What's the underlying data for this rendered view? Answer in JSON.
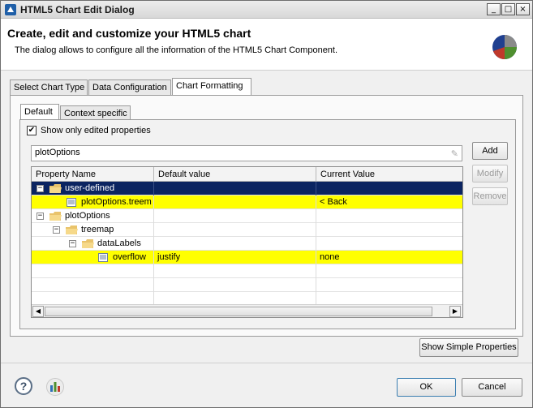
{
  "window": {
    "title": "HTML5 Chart Edit Dialog"
  },
  "window_controls": {
    "minimize": "_",
    "maximize": "□",
    "close": "×"
  },
  "header": {
    "title": "Create, edit and customize your HTML5 chart",
    "description": "The dialog allows to configure all the information of the HTML5 Chart Component."
  },
  "main_tabs": [
    {
      "label": "Select Chart Type",
      "active": false
    },
    {
      "label": "Data Configuration",
      "active": false
    },
    {
      "label": "Chart Formatting",
      "active": true
    }
  ],
  "sub_tabs": [
    {
      "label": "Default",
      "active": true
    },
    {
      "label": "Context specific",
      "active": false
    }
  ],
  "show_only_edited": {
    "label": "Show only edited properties",
    "checked": true,
    "mark": "✔"
  },
  "search": {
    "value": "plotOptions"
  },
  "side_buttons": {
    "add": "Add",
    "modify": "Modify",
    "remove": "Remove"
  },
  "table": {
    "columns": [
      "Property Name",
      "Default value",
      "Current Value"
    ],
    "rows": [
      {
        "name": "user-defined",
        "default": "",
        "current": "",
        "type": "folder",
        "toggle": "−",
        "state": "selected"
      },
      {
        "name": "plotOptions.treem",
        "default": "",
        "current": "< Back",
        "type": "property",
        "state": "highlight"
      },
      {
        "name": "plotOptions",
        "default": "",
        "current": "",
        "type": "folder",
        "toggle": "−",
        "state": "normal"
      },
      {
        "name": "treemap",
        "default": "",
        "current": "",
        "type": "folder",
        "toggle": "−",
        "state": "normal"
      },
      {
        "name": "dataLabels",
        "default": "",
        "current": "",
        "type": "folder",
        "toggle": "−",
        "state": "normal"
      },
      {
        "name": "overflow",
        "default": "justify",
        "current": "none",
        "type": "property",
        "state": "highlight"
      }
    ]
  },
  "scrollbar": {
    "left_arrow": "◀",
    "right_arrow": "▶"
  },
  "show_simple_button": "Show Simple Properties",
  "footer": {
    "help": "?",
    "ok": "OK",
    "cancel": "Cancel"
  },
  "colors": {
    "selected_row": "#0b2461",
    "highlight_row": "#ffff00",
    "pie_red": "#c0392b",
    "pie_blue": "#1f3f8f",
    "pie_green": "#4f8f2f"
  }
}
